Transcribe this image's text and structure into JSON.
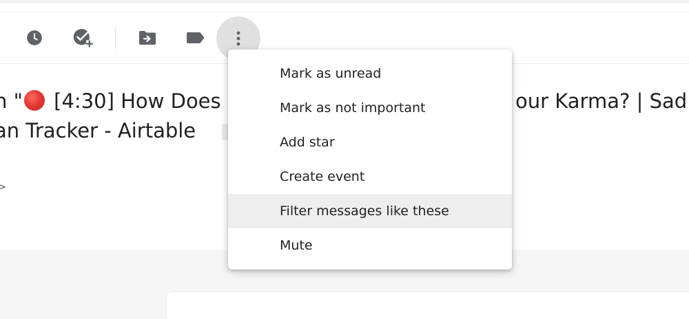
{
  "toolbar": {
    "buttons": [
      {
        "icon": "clock-icon",
        "label": "Snooze"
      },
      {
        "icon": "add-task-icon",
        "label": "Add to Tasks"
      },
      {
        "icon": "move-to-icon",
        "label": "Move to"
      },
      {
        "icon": "label-icon",
        "label": "Labels"
      },
      {
        "icon": "more-vert-icon",
        "label": "More"
      }
    ]
  },
  "email": {
    "subject_line1_prefix": "n \"",
    "subject_line1_middle": " [4:30] How Does",
    "subject_line1_right": "our Karma? | Sad",
    "subject_line2": "an Tracker - Airtable",
    "collapse_glyph": ">"
  },
  "menu": {
    "items": [
      {
        "label": "Mark as unread"
      },
      {
        "label": "Mark as not important"
      },
      {
        "label": "Add star"
      },
      {
        "label": "Create event"
      },
      {
        "label": "Filter messages like these",
        "highlighted": true
      },
      {
        "label": "Mute"
      }
    ]
  },
  "colors": {
    "icon": "#5f6368",
    "text": "#202124",
    "menu_hover": "#eeeeee",
    "active_button_bg": "#e0e0e0",
    "red_dot": "#e53935"
  }
}
